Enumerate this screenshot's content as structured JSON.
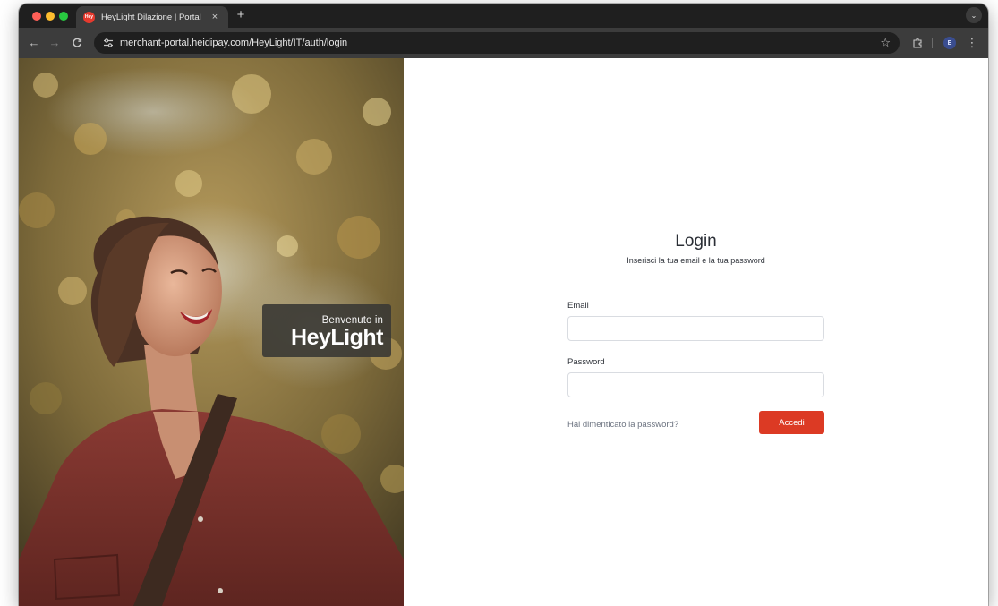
{
  "browser": {
    "tab": {
      "favicon_text": "Hey",
      "title": "HeyLight Dilazione | Portal",
      "close_glyph": "×"
    },
    "new_tab_glyph": "+",
    "tab_menu_glyph": "⌄",
    "toolbar": {
      "back_glyph": "←",
      "forward_glyph": "→",
      "reload_glyph": "C",
      "site_info_glyph": "⚙",
      "url": "merchant-portal.heidipay.com/HeyLight/IT/auth/login",
      "star_glyph": "☆",
      "extensions_glyph": "⬚",
      "profile_initial": "E",
      "menu_glyph": "⋮"
    }
  },
  "hero": {
    "welcome_text": "Benvenuto in",
    "brand": "HeyLight"
  },
  "login": {
    "title": "Login",
    "subtitle": "Inserisci la tua email e la tua password",
    "email_label": "Email",
    "email_value": "",
    "password_label": "Password",
    "password_value": "",
    "forgot_link": "Hai dimenticato la password?",
    "submit_label": "Accedi"
  },
  "colors": {
    "accent": "#dc3a24",
    "browser_frame": "#1f1f1f",
    "toolbar": "#3c3c3c"
  }
}
